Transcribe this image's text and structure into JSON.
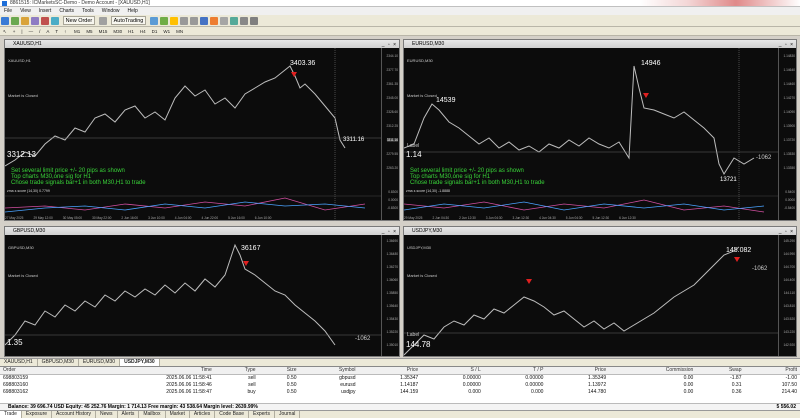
{
  "window": {
    "title": "8861515: ICMarketsSC-Demo - Demo Account - [XAUUSD,H1]"
  },
  "menu": [
    "File",
    "View",
    "Insert",
    "Charts",
    "Tools",
    "Window",
    "Help"
  ],
  "toolbar": {
    "new_order": "New Order",
    "autotrading": "AutoTrading"
  },
  "timeframes": [
    "M1",
    "M5",
    "M15",
    "M30",
    "H1",
    "H4",
    "D1",
    "W1",
    "MN"
  ],
  "charts": [
    {
      "title": "XAUUSD,H1",
      "symbol": "XAUUSD,H1",
      "market": "Market is Closed",
      "hi_label": "3403.36",
      "last": "3311.16",
      "left_val": "3312.13",
      "ask": "3311.16",
      "axis": [
        "2344.10",
        "2377.70",
        "2361.35",
        "2345.00",
        "2328.60",
        "2312.25",
        "3311.16",
        "2279.55",
        "2263.20"
      ],
      "times": [
        "27 May 2025",
        "29 May 12:00",
        "30 May 05:00",
        "30 May 22:00",
        "2 Jun 16:00",
        "3 Jun 10:00",
        "4 Jun 04:00",
        "4 Jun 22:00",
        "5 Jun 16:00",
        "6 Jun 10:00"
      ],
      "indicator": "zma z-score (14,30) 0.7799",
      "ind_axis": [
        "0.8300",
        "0.0000",
        "-0.8300"
      ]
    },
    {
      "title": "EURUSD,M30",
      "symbol": "EURUSD,M30",
      "market": "Market is Closed",
      "hi_label": "14946",
      "lo_label": "14539",
      "last": "13721",
      "left_val": "1.14",
      "ask": "-1062",
      "axis": [
        "1.14830",
        "1.14640",
        "1.14460",
        "1.14270",
        "1.14090",
        "1.13900",
        "1.13720",
        "1.13530",
        "1.13350"
      ],
      "times": [
        "29 May 2025",
        "2 Jun 04:30",
        "2 Jun 12:30",
        "3 Jun 04:30",
        "3 Jun 12:30",
        "4 Jun 04:30",
        "5 Jun 04:30",
        "5 Jun 12:30",
        "6 Jun 12:30"
      ],
      "indicator": "zma z-score (14,30) -1.8888",
      "ind_axis": [
        "0.5400",
        "0.0000",
        "-0.5400"
      ]
    },
    {
      "title": "GBPUSD,M30",
      "symbol": "GBPUSD,M30",
      "market": "Market is Closed",
      "hi_label": "36167",
      "left_val": "1.35",
      "ask": "-1062",
      "axis": [
        "1.36690",
        "1.36480",
        "1.36270",
        "1.36060",
        "1.35850",
        "1.35640",
        "1.35430",
        "1.35220",
        "1.35010"
      ],
      "times": [],
      "indicator": "",
      "ind_axis": []
    },
    {
      "title": "USDJPY,M30",
      "symbol": "USDJPY,M30",
      "market": "Market is Closed",
      "hi_label": "145.082",
      "left_val": "144.78",
      "ask": "-1062",
      "axis": [
        "145.290",
        "144.990",
        "144.700",
        "144.400",
        "144.110",
        "143.810",
        "143.520",
        "143.220",
        "142.920"
      ],
      "times": [],
      "indicator": "",
      "ind_axis": []
    }
  ],
  "overlay": {
    "line1": "Set several limit price +/- 20 pips as shown",
    "line2": "Top charts M30,one sig for H1",
    "line3": "Chose trade signals bar+1 in both M30,H1 to trade",
    "label": "Label"
  },
  "chart_tabs": [
    "XAUUSD,H1",
    "GBPUSD,M30",
    "EURUSD,M30",
    "USDJPY,M30"
  ],
  "terminal": {
    "columns": [
      "Order",
      "Time",
      "Type",
      "Size",
      "Symbol",
      "Price",
      "S / L",
      "T / P",
      "Price",
      "Commission",
      "Swap",
      "Profit"
    ],
    "rows": [
      [
        "698803159",
        "2025.06.06 11:58:41",
        "sell",
        "0.50",
        "gbpusd",
        "1.35347",
        "0.00000",
        "0.00000",
        "1.35349",
        "0.00",
        "-1.87",
        "-1.00"
      ],
      [
        "698803160",
        "2025.06.06 11:58:46",
        "sell",
        "0.50",
        "eurusd",
        "1.14187",
        "0.00000",
        "0.00000",
        "1.13972",
        "0.00",
        "0.31",
        "107.50"
      ],
      [
        "698803162",
        "2025.06.06 11:58:47",
        "buy",
        "0.50",
        "usdjpy",
        "144.159",
        "0.000",
        "0.000",
        "144.780",
        "0.00",
        "0.36",
        "214.40"
      ]
    ],
    "balance": "Balance: 39 696.74 USD  Equity: 45 252.76  Margin: 1 714.13  Free margin: 43 538.64  Margin level: 2639.99%",
    "total_profit": "5 556.02"
  },
  "bottom_tabs": [
    "Trade",
    "Exposure",
    "Account History",
    "News",
    "Alerts",
    "Mailbox",
    "Market",
    "Articles",
    "Code Base",
    "Experts",
    "Journal"
  ]
}
